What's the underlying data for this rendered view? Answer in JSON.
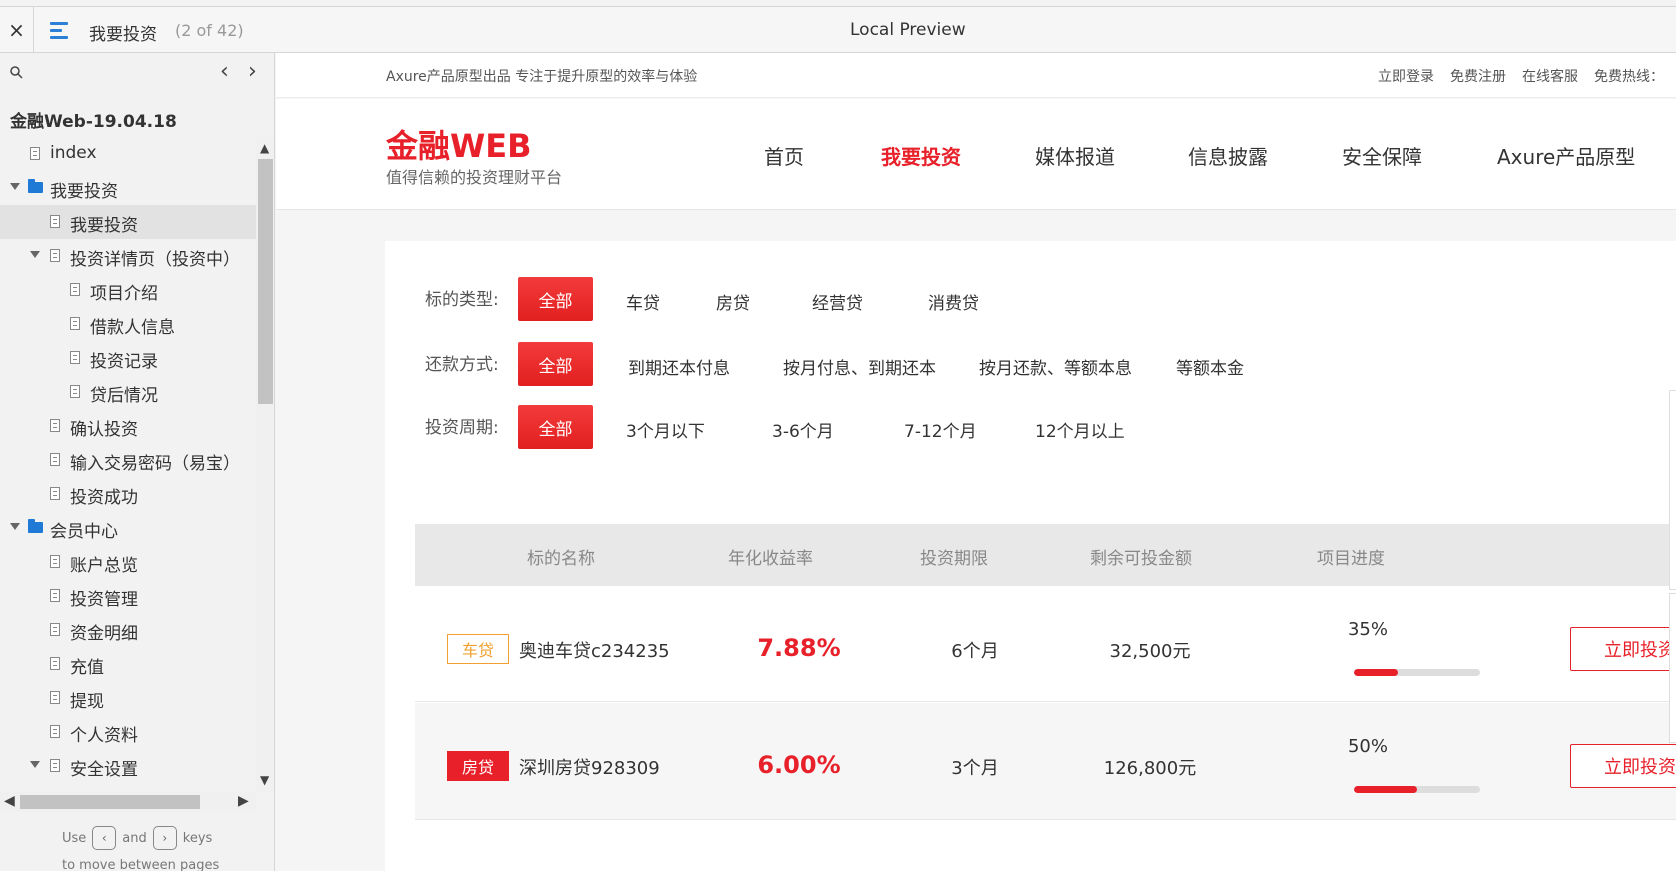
{
  "topbar": {
    "close": "×",
    "page_name": "我要投资",
    "page_count": "(2 of 42)",
    "title": "Local Preview"
  },
  "sidebar": {
    "project": "金融Web-19.04.18",
    "items": [
      {
        "label": "index",
        "indent": 0,
        "type": "doc",
        "arrow": false,
        "selected": false
      },
      {
        "label": "我要投资",
        "indent": 0,
        "type": "folder",
        "arrow": true,
        "selected": false
      },
      {
        "label": "我要投资",
        "indent": 1,
        "type": "doc",
        "arrow": false,
        "selected": true
      },
      {
        "label": "投资详情页（投资中）",
        "indent": 1,
        "type": "doc",
        "arrow": true,
        "selected": false
      },
      {
        "label": "项目介绍",
        "indent": 2,
        "type": "doc",
        "arrow": false,
        "selected": false
      },
      {
        "label": "借款人信息",
        "indent": 2,
        "type": "doc",
        "arrow": false,
        "selected": false
      },
      {
        "label": "投资记录",
        "indent": 2,
        "type": "doc",
        "arrow": false,
        "selected": false
      },
      {
        "label": "贷后情况",
        "indent": 2,
        "type": "doc",
        "arrow": false,
        "selected": false
      },
      {
        "label": "确认投资",
        "indent": 1,
        "type": "doc",
        "arrow": false,
        "selected": false
      },
      {
        "label": "输入交易密码（易宝）",
        "indent": 1,
        "type": "doc",
        "arrow": false,
        "selected": false
      },
      {
        "label": "投资成功",
        "indent": 1,
        "type": "doc",
        "arrow": false,
        "selected": false
      },
      {
        "label": "会员中心",
        "indent": 0,
        "type": "folder",
        "arrow": true,
        "selected": false
      },
      {
        "label": "账户总览",
        "indent": 1,
        "type": "doc",
        "arrow": false,
        "selected": false
      },
      {
        "label": "投资管理",
        "indent": 1,
        "type": "doc",
        "arrow": false,
        "selected": false
      },
      {
        "label": "资金明细",
        "indent": 1,
        "type": "doc",
        "arrow": false,
        "selected": false
      },
      {
        "label": "充值",
        "indent": 1,
        "type": "doc",
        "arrow": false,
        "selected": false
      },
      {
        "label": "提现",
        "indent": 1,
        "type": "doc",
        "arrow": false,
        "selected": false
      },
      {
        "label": "个人资料",
        "indent": 1,
        "type": "doc",
        "arrow": false,
        "selected": false
      },
      {
        "label": "安全设置",
        "indent": 1,
        "type": "doc",
        "arrow": true,
        "selected": false
      }
    ],
    "hint_use": "Use",
    "hint_and": "and",
    "hint_keys": "keys",
    "hint_line2": "to move between pages"
  },
  "site": {
    "slogan": "Axure产品原型出品 专注于提升原型的效率与体验",
    "util_links": [
      "立即登录",
      "免费注册",
      "在线客服",
      "免费热线："
    ],
    "logo": "金融WEB",
    "tagline": "值得信赖的投资理财平台",
    "nav": [
      {
        "label": "首页",
        "active": false
      },
      {
        "label": "我要投资",
        "active": true
      },
      {
        "label": "媒体报道",
        "active": false
      },
      {
        "label": "信息披露",
        "active": false
      },
      {
        "label": "安全保障",
        "active": false
      },
      {
        "label": "Axure产品原型",
        "active": false
      }
    ]
  },
  "filters": [
    {
      "label": "标的类型:",
      "all": "全部",
      "options": [
        "车贷",
        "房贷",
        "经营贷",
        "消费贷"
      ]
    },
    {
      "label": "还款方式:",
      "all": "全部",
      "options": [
        "到期还本付息",
        "按月付息、到期还本",
        "按月还款、等额本息",
        "等额本金"
      ]
    },
    {
      "label": "投资周期:",
      "all": "全部",
      "options": [
        "3个月以下",
        "3-6个月",
        "7-12个月",
        "12个月以上"
      ]
    }
  ],
  "table": {
    "headers": [
      "标的名称",
      "年化收益率",
      "投资期限",
      "剩余可投金额",
      "项目进度"
    ],
    "rows": [
      {
        "tag": "车贷",
        "tag_style": "outline",
        "name": "奥迪车贷c234235",
        "rate": "7.88%",
        "period": "6个月",
        "amount": "32,500元",
        "progress_label": "35%",
        "progress": 0.35,
        "button": "立即投资"
      },
      {
        "tag": "房贷",
        "tag_style": "solid",
        "name": "深圳房贷928309",
        "rate": "6.00%",
        "period": "3个月",
        "amount": "126,800元",
        "progress_label": "50%",
        "progress": 0.5,
        "button": "立即投资"
      }
    ]
  },
  "colors": {
    "accent": "#e8202a",
    "link_blue": "#1f7ad6",
    "tag_orange": "#f0a030"
  }
}
